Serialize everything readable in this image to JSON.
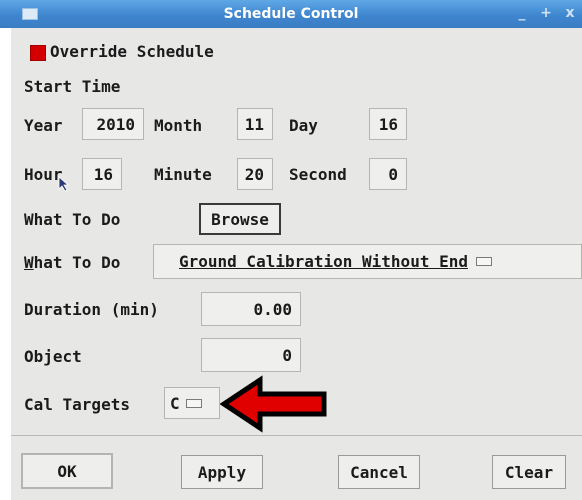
{
  "window": {
    "title": "Schedule Control",
    "controls": [
      "_",
      "+",
      "x"
    ]
  },
  "override": {
    "label": "Override Schedule",
    "checked": true
  },
  "start_time": {
    "label": "Start Time"
  },
  "date": {
    "year_label": "Year",
    "year": "2010",
    "month_label": "Month",
    "month": "11",
    "day_label": "Day",
    "day": "16"
  },
  "time": {
    "hour_label": "Hour",
    "hour": "16",
    "minute_label": "Minute",
    "minute": "20",
    "second_label": "Second",
    "second": "0"
  },
  "what_to_do_browse": {
    "label": "What To Do",
    "button": "Browse"
  },
  "what_to_do_menu": {
    "label": "What To Do",
    "value": "Ground Calibration Without End"
  },
  "duration": {
    "label": "Duration (min)",
    "value": "0.00"
  },
  "object": {
    "label": "Object",
    "value": "0"
  },
  "cal_targets": {
    "label": "Cal Targets",
    "value": "C"
  },
  "buttons": {
    "ok": "OK",
    "apply": "Apply",
    "cancel": "Cancel",
    "clear": "Clear"
  },
  "colors": {
    "titlebar": "#3f86cf",
    "checkbox": "#d40000",
    "arrow": "#e00000"
  }
}
